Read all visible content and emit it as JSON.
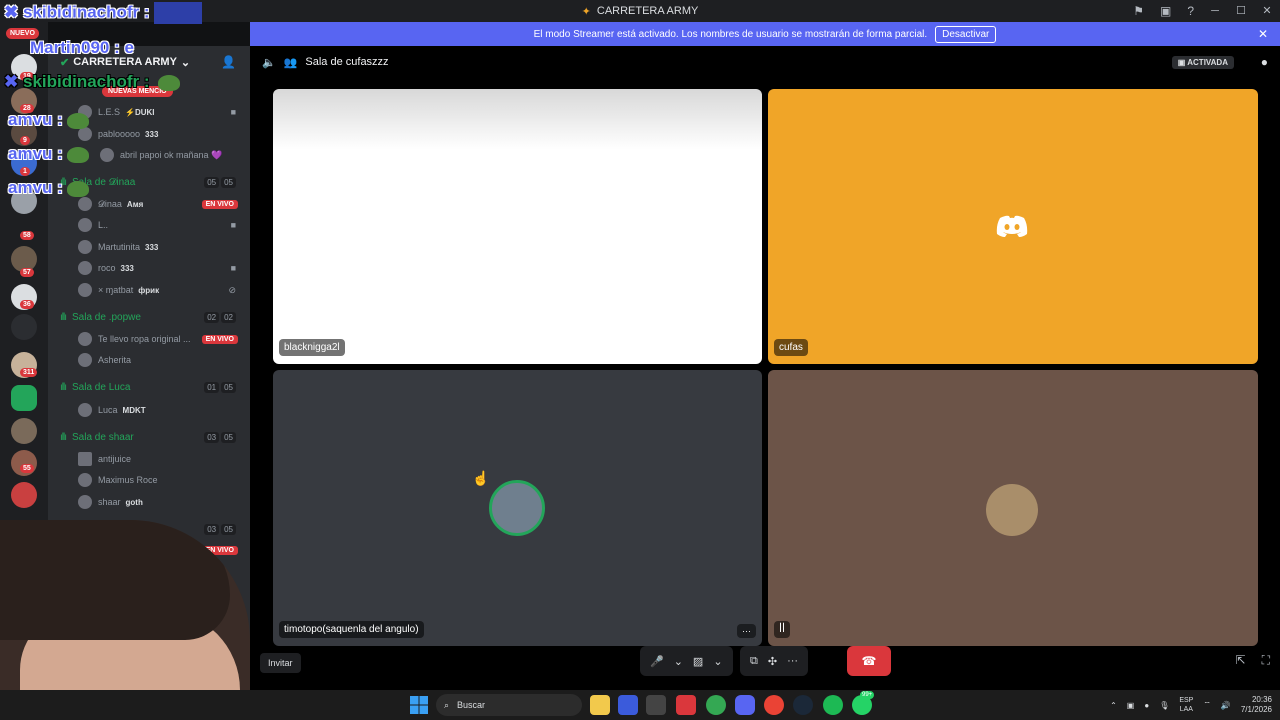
{
  "window": {
    "title": "CARRETERA ARMY",
    "controls": [
      "─",
      "☐",
      "✕"
    ]
  },
  "streamer_banner": {
    "message": "El modo Streamer está activado. Los nombres de usuario se mostrarán de forma parcial.",
    "button": "Desactivar"
  },
  "servers": {
    "new_badge": "NUEVO",
    "badges": [
      "19",
      "28",
      "9",
      "1",
      "58",
      "57",
      "36",
      "311",
      "55"
    ]
  },
  "guild": {
    "name": "CARRETERA ARMY"
  },
  "sidebar": {
    "mentions_pill": "NUEVAS MENCIO",
    "rows": [
      {
        "name": "L.E.S",
        "tag": "⚡DUKI"
      },
      {
        "name": "pablooooo",
        "tag": "333"
      },
      {
        "name": "abril papoi ok mañana 💜",
        "tag": ""
      }
    ],
    "voice_channels": [
      {
        "name": "Sala de 𝓓inaa",
        "count_a": "05",
        "count_b": "05",
        "members": [
          {
            "name": "𝓓inaa",
            "tag": "Aмя",
            "live": "EN VIVO"
          },
          {
            "name": "L..",
            "tag": ""
          },
          {
            "name": "Martutinita",
            "tag": "333"
          },
          {
            "name": "roco",
            "tag": "333"
          },
          {
            "name": "× ɱatbat",
            "tag": "фрик"
          }
        ]
      },
      {
        "name": "Sala de .popwe",
        "count_a": "02",
        "count_b": "02",
        "members": [
          {
            "name": "Te llevo ropa original ...",
            "tag": "",
            "live": "EN VIVO"
          },
          {
            "name": "Asherita",
            "tag": ""
          }
        ]
      },
      {
        "name": "Sala de Luca",
        "count_a": "01",
        "count_b": "05",
        "members": [
          {
            "name": "Luca",
            "tag": "MDKT"
          }
        ]
      },
      {
        "name": "Sala de shaar",
        "count_a": "03",
        "count_b": "05",
        "members": [
          {
            "name": "antijuice",
            "tag": ""
          },
          {
            "name": "Maximus Roce",
            "tag": ""
          },
          {
            "name": "shaar",
            "tag": "goth"
          }
        ]
      }
    ],
    "extra_count_a": "03",
    "extra_count_b": "05",
    "extra_live": "EN VIVO"
  },
  "overlay": {
    "chat1_user": "skibidinachofr :",
    "chat2_user": "Martin090 : e",
    "chat3_user": "skibidinachofr :",
    "amvu": "amvu :"
  },
  "call": {
    "channel": "Sala de cufaszzz",
    "activity_badge": "ACTIVADA",
    "tiles": [
      {
        "name": "blacknigga2l"
      },
      {
        "name": "cufas"
      },
      {
        "name": "timotopo(saquenla del angulo)",
        "more": "···"
      },
      {
        "name": "",
        "more": "ꟾꟾ"
      }
    ],
    "invite": "Invitar"
  },
  "taskbar": {
    "search_placeholder": "Buscar",
    "lang_a": "ESP",
    "lang_b": "LAA",
    "time": "20:36",
    "date": "7/1/2026",
    "notif_badge": "99+"
  },
  "colors": {
    "blurple": "#5865f2",
    "green": "#23a55a",
    "red": "#da373c",
    "orange_tile": "#f0a528"
  }
}
